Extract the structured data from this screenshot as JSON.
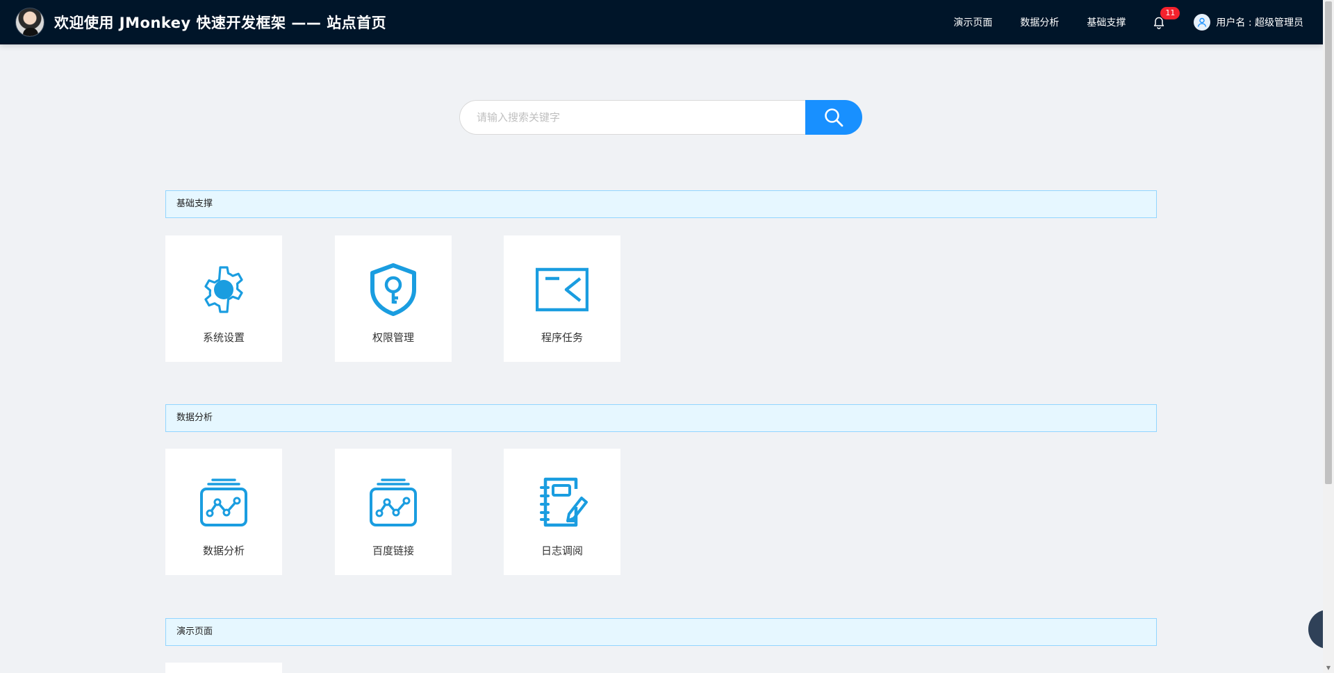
{
  "header": {
    "title": "欢迎使用 JMonkey 快速开发框架 —— 站点首页",
    "nav": [
      "演示页面",
      "数据分析",
      "基础支撑"
    ],
    "notification_count": "11",
    "user_label": "用户名 : 超级管理员",
    "brand_color": "#001529"
  },
  "search": {
    "placeholder": "请输入搜索关键字",
    "button_color": "#1890ff"
  },
  "sections": [
    {
      "title": "基础支撑",
      "cards": [
        {
          "label": "系统设置",
          "icon": "gear-icon"
        },
        {
          "label": "权限管理",
          "icon": "shield-key-icon"
        },
        {
          "label": "程序任务",
          "icon": "terminal-icon"
        }
      ]
    },
    {
      "title": "数据分析",
      "cards": [
        {
          "label": "数据分析",
          "icon": "chart-card-icon"
        },
        {
          "label": "百度链接",
          "icon": "chart-card-icon"
        },
        {
          "label": "日志调阅",
          "icon": "notebook-pen-icon"
        }
      ]
    },
    {
      "title": "演示页面",
      "cards": []
    }
  ],
  "icon_color": "#1a9de0"
}
